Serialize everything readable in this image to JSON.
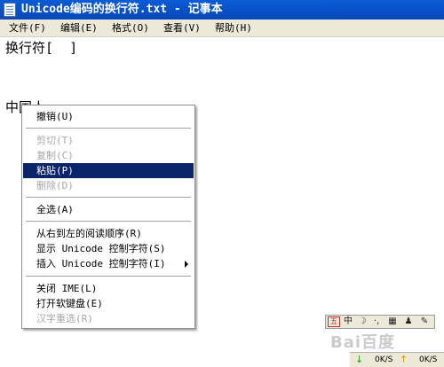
{
  "window": {
    "title": "Unicode编码的换行符.txt - 记事本"
  },
  "menubar": {
    "items": [
      {
        "label": "文件(F)"
      },
      {
        "label": "编辑(E)"
      },
      {
        "label": "格式(O)"
      },
      {
        "label": "查看(V)"
      },
      {
        "label": "帮助(H)"
      }
    ]
  },
  "editor": {
    "lines": [
      "换行符[  ]",
      "中国人"
    ]
  },
  "context_menu": {
    "items": [
      {
        "label": "撤销(U)",
        "disabled": false
      },
      {
        "label": "剪切(T)",
        "disabled": true
      },
      {
        "label": "复制(C)",
        "disabled": true
      },
      {
        "label": "粘贴(P)",
        "disabled": false,
        "highlighted": true
      },
      {
        "label": "删除(D)",
        "disabled": true
      },
      {
        "label": "全选(A)",
        "disabled": false
      },
      {
        "label": "从右到左的阅读顺序(R)",
        "disabled": false
      },
      {
        "label": "显示 Unicode 控制字符(S)",
        "disabled": false
      },
      {
        "label": "插入 Unicode 控制字符(I)",
        "disabled": false,
        "submenu": true
      },
      {
        "label": "关闭 IME(L)",
        "disabled": false
      },
      {
        "label": "打开软键盘(E)",
        "disabled": false
      },
      {
        "label": "汉字重选(R)",
        "disabled": true
      }
    ]
  },
  "ime_bar": {
    "buttons": [
      {
        "icon": "wubi-icon",
        "text": "五"
      },
      {
        "icon": "chinese-mode-icon",
        "text": "中"
      },
      {
        "icon": "moon-icon",
        "text": "☽"
      },
      {
        "icon": "punctuation-icon",
        "text": "·,"
      },
      {
        "icon": "keyboard-icon",
        "text": "▦"
      },
      {
        "icon": "user-icon",
        "text": "♟"
      },
      {
        "icon": "wrench-icon",
        "text": "✎"
      }
    ]
  },
  "watermark": {
    "text": "Bai百度"
  },
  "netspeed": {
    "down": "0K/S",
    "up": "0K/S"
  },
  "colors": {
    "titlebar": "#0a5bd6",
    "menu_highlight": "#0a246a",
    "disabled_text": "#a7a6aa"
  }
}
